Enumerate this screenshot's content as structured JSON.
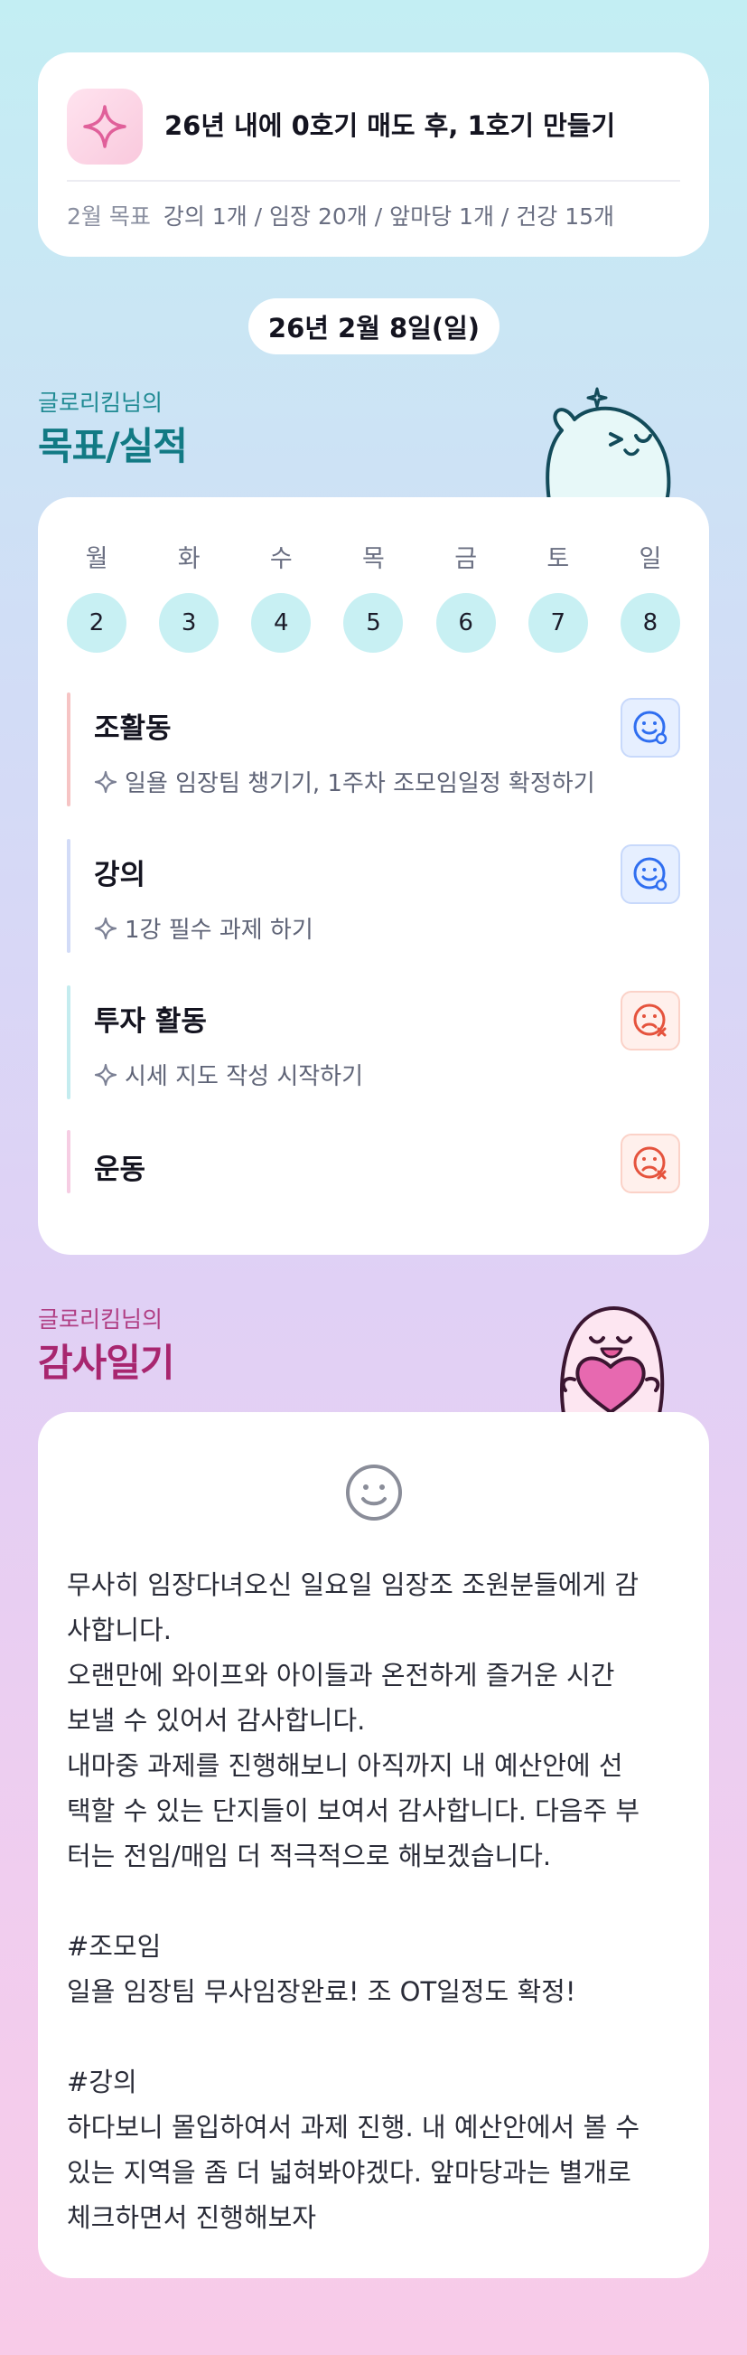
{
  "goal": {
    "icon": "sparkle-icon",
    "title": "26년 내에 0호기 매도 후, 1호기 만들기",
    "month_label": "2월 목표",
    "month_items": "강의 1개 / 임장 20개 / 앞마당 1개 / 건강 15개"
  },
  "date_pill": "26년 2월 8일(일)",
  "plan_section": {
    "subtitle": "글로리킴님의",
    "title": "목표/실적"
  },
  "week": {
    "days": [
      "월",
      "화",
      "수",
      "목",
      "금",
      "토",
      "일"
    ],
    "dates": [
      "2",
      "3",
      "4",
      "5",
      "6",
      "7",
      "8"
    ]
  },
  "activities": [
    {
      "title": "조활동",
      "detail": "일욜 임장팀 챙기기, 1주차 조모임일정 확정하기",
      "status": "good",
      "bar_color": "#f6c4c4"
    },
    {
      "title": "강의",
      "detail": "1강 필수 과제 하기",
      "status": "good",
      "bar_color": "#d2dbf7"
    },
    {
      "title": "투자 활동",
      "detail": "시세 지도 작성 시작하기",
      "status": "bad",
      "bar_color": "#c4ecef"
    },
    {
      "title": "운동",
      "detail": "",
      "status": "bad",
      "bar_color": "#f6cde3"
    }
  ],
  "diary_section": {
    "subtitle": "글로리킴님의",
    "title": "감사일기"
  },
  "diary": {
    "text": "무사히 임장다녀오신 일요일 임장조 조원분들에게 감\n사합니다.\n오랜만에 와이프와 아이들과 온전하게 즐거운 시간\n보낼 수 있어서 감사합니다.\n내마중 과제를 진행해보니 아직까지 내 예산안에 선\n택할 수 있는 단지들이 보여서 감사합니다. 다음주 부\n터는 전임/매임 더 적극적으로 해보겠습니다.\n\n#조모임\n일욜 임장팀 무사임장완료! 조 OT일정도 확정!\n\n#강의\n하다보니 몰입하여서 과제 진행. 내 예산안에서 볼 수\n있는 지역을 좀 더 넓혀봐야겠다. 앞마당과는 별개로\n체크하면서 진행해보자"
  }
}
